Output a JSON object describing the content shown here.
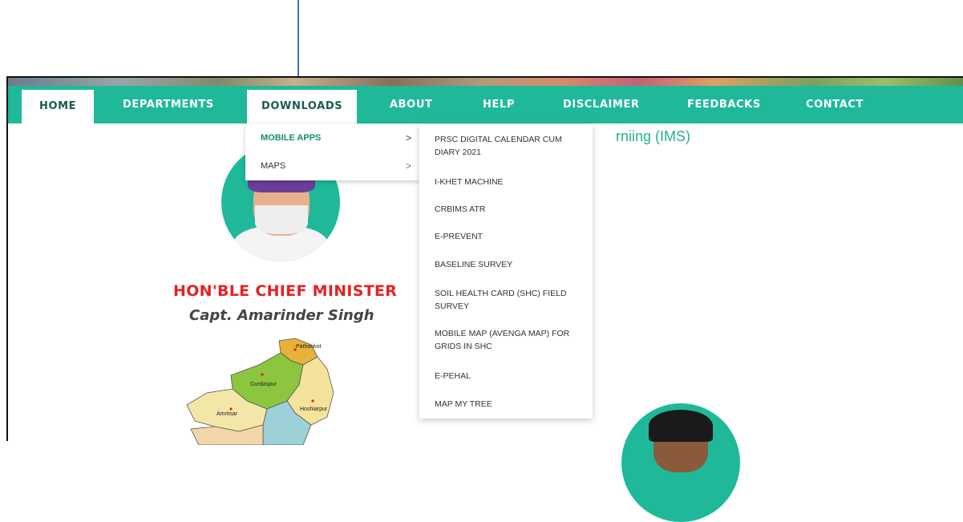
{
  "nav": {
    "home": "HOME",
    "departments": "DEPARTMENTS",
    "downloads": "DOWNLOADS",
    "about": "ABOUT",
    "help": "HELP",
    "disclaimer": "DISCLAIMER",
    "feedbacks": "FEEDBACKS",
    "contact": "CONTACT"
  },
  "downloads_menu": [
    {
      "label": "MOBILE APPS",
      "arrow": ">"
    },
    {
      "label": "MAPS",
      "arrow": ">"
    }
  ],
  "mobile_apps_menu": [
    "PRSC DIGITAL CALENDAR CUM DIARY 2021",
    "I-KHET MACHINE",
    "CRBIMS ATR",
    "E-PREVENT",
    "BASELINE SURVEY",
    "SOIL HEALTH CARD (SHC) FIELD SURVEY",
    "MOBILE MAP (AVENGA MAP) FOR GRIDS IN SHC",
    "E-PEHAL",
    "MAP MY TREE"
  ],
  "page_title_partial": "rniing (IMS)",
  "chief_minister": {
    "title": "HON'BLE CHIEF MINISTER",
    "name": "Capt. Amarinder Singh"
  },
  "map_labels": {
    "pathankot": "Pathankot",
    "gurdaspur": "Gurdaspur",
    "hoshiarpur": "Hoshiarpur",
    "amritsar": "Amritsar"
  },
  "colors": {
    "nav_bg": "#1fb99a",
    "title_red": "#e52222",
    "accent_green": "#23b28f"
  }
}
